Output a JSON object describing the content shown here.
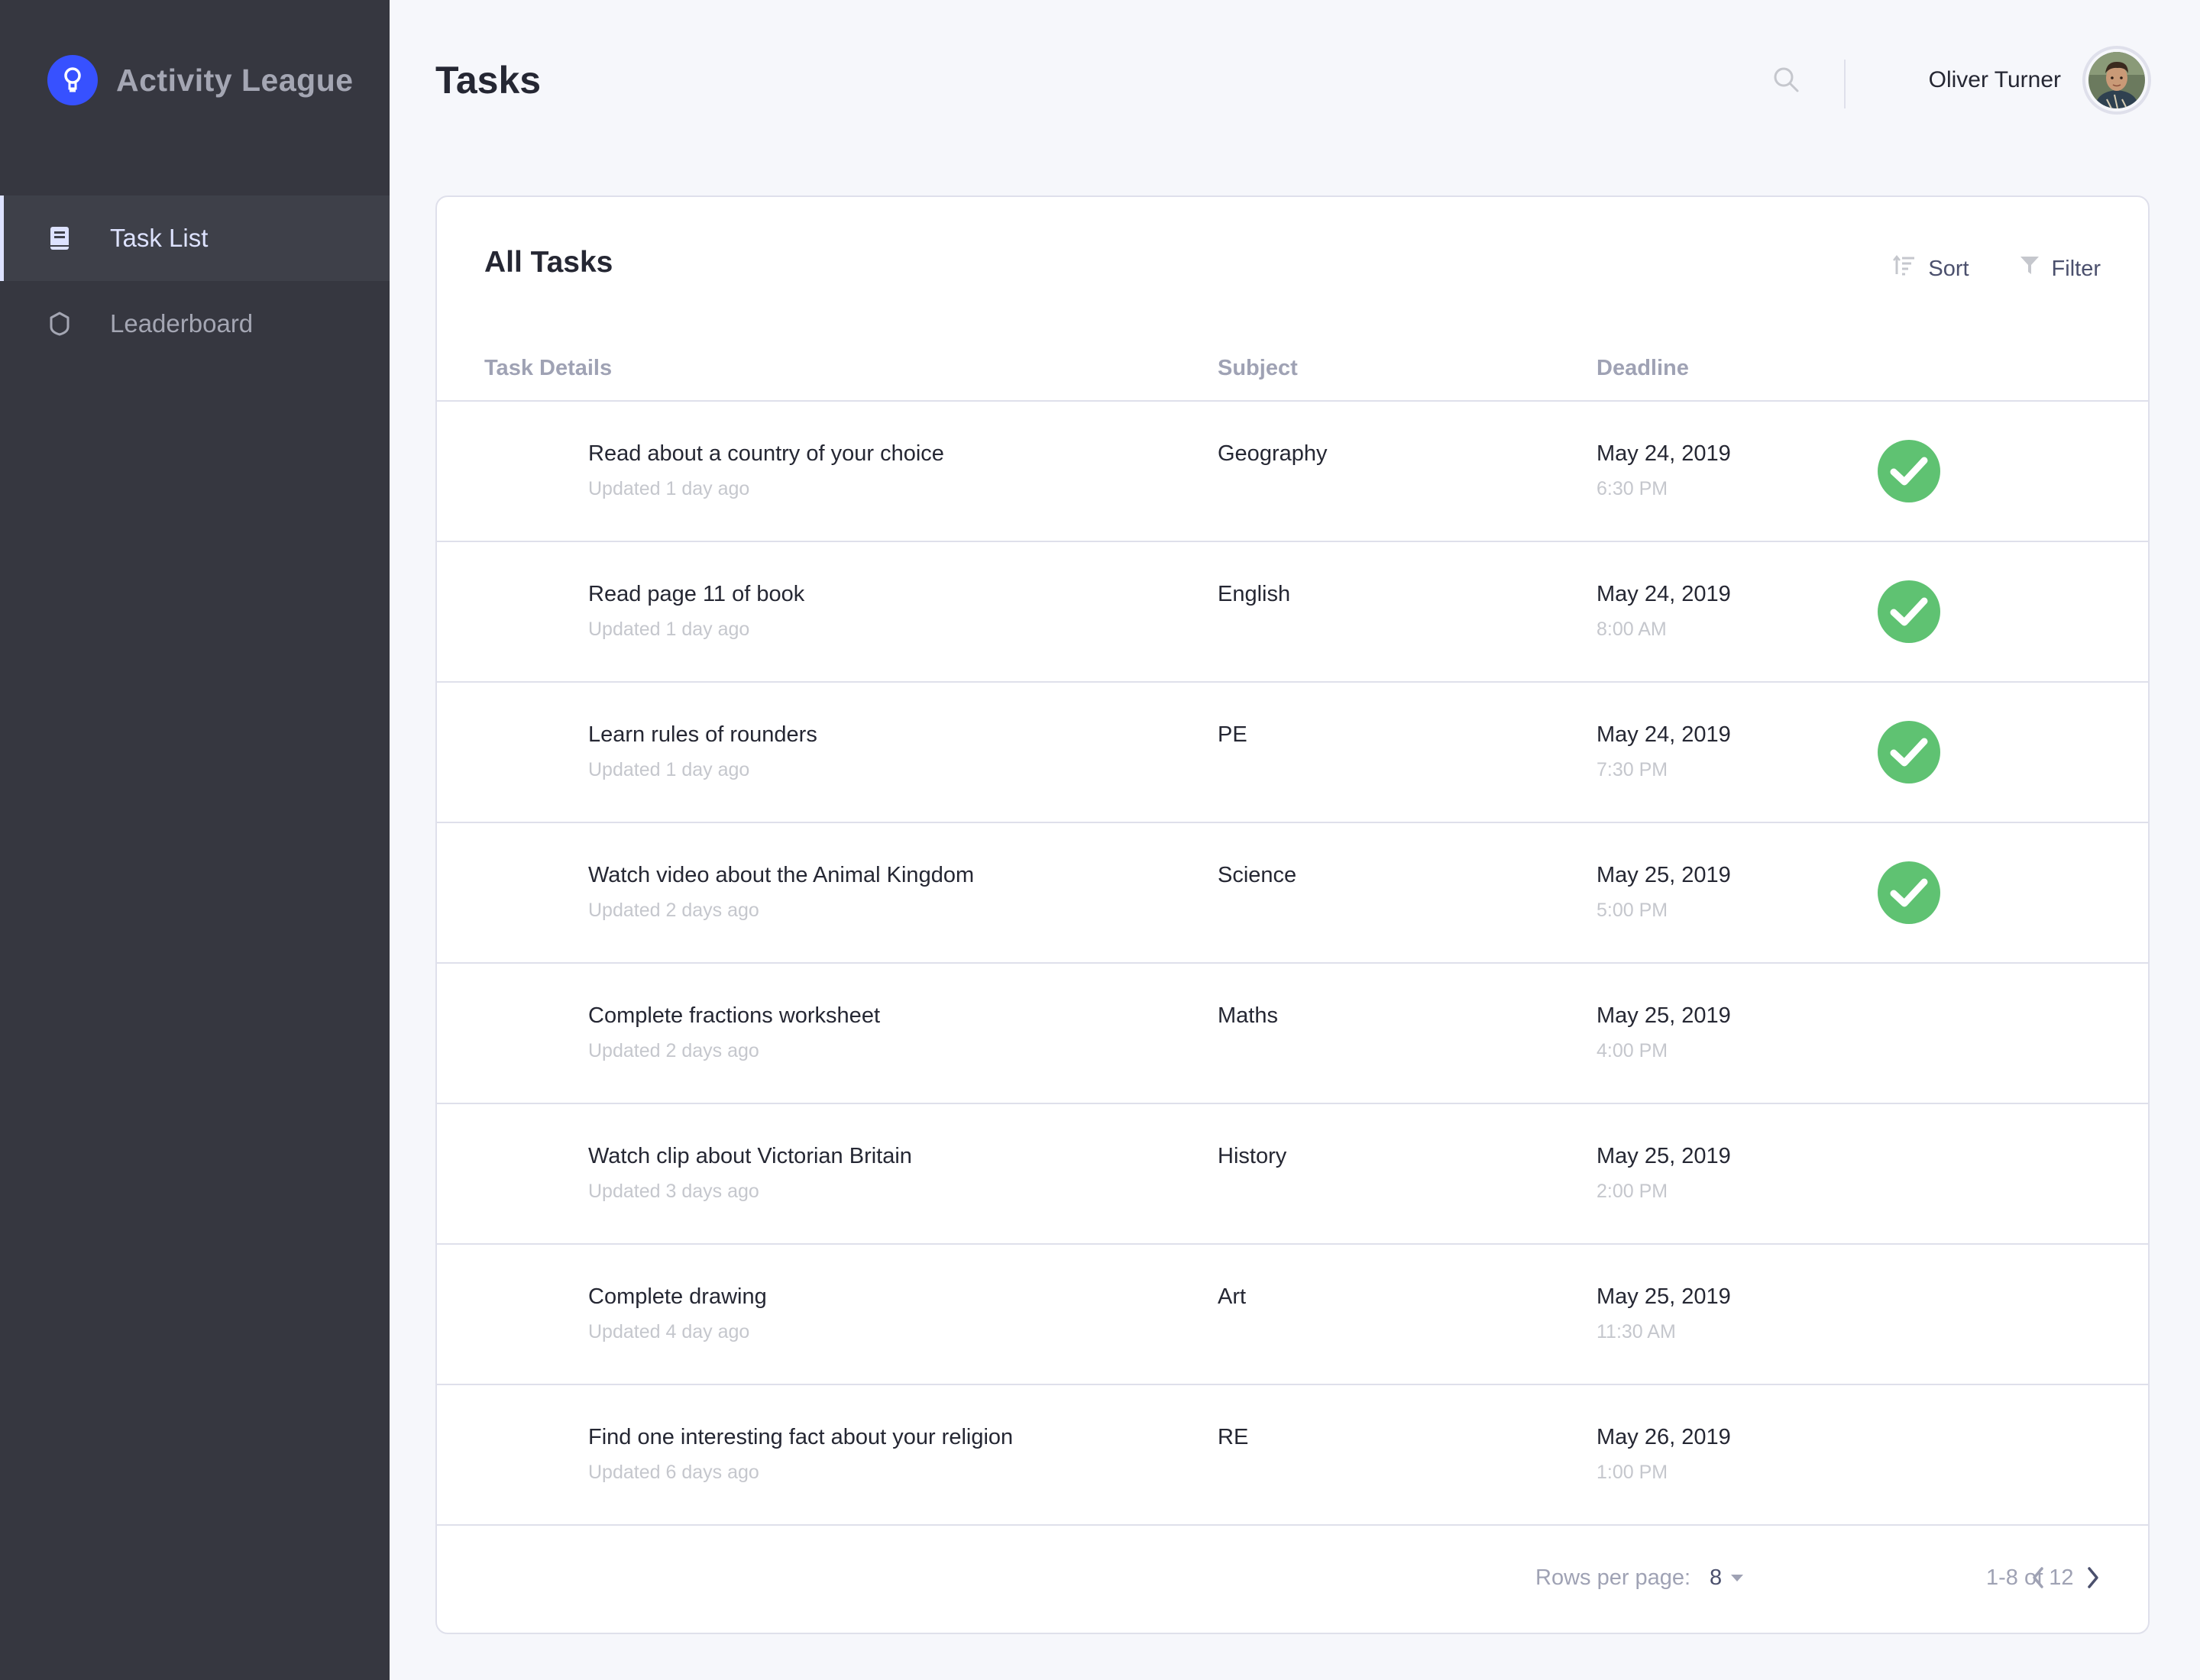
{
  "app": {
    "name": "Activity League"
  },
  "sidebar": {
    "items": [
      {
        "label": "Task List",
        "icon": "book-icon",
        "active": true
      },
      {
        "label": "Leaderboard",
        "icon": "shield-icon",
        "active": false
      }
    ]
  },
  "header": {
    "title": "Tasks",
    "user_name": "Oliver Turner"
  },
  "card": {
    "title": "All Tasks",
    "sort_label": "Sort",
    "filter_label": "Filter",
    "columns": [
      "Task Details",
      "Subject",
      "Deadline"
    ]
  },
  "tasks": [
    {
      "name": "Read about a country of your choice",
      "updated": "Updated 1 day ago",
      "subject": "Geography",
      "date": "May 24, 2019",
      "time": "6:30 PM",
      "completed": true
    },
    {
      "name": "Read page 11 of book",
      "updated": "Updated 1 day ago",
      "subject": "English",
      "date": "May 24, 2019",
      "time": "8:00 AM",
      "completed": true
    },
    {
      "name": "Learn rules of rounders",
      "updated": "Updated 1 day ago",
      "subject": "PE",
      "date": "May 24, 2019",
      "time": "7:30 PM",
      "completed": true
    },
    {
      "name": "Watch video about the Animal Kingdom",
      "updated": "Updated 2 days ago",
      "subject": "Science",
      "date": "May 25, 2019",
      "time": "5:00 PM",
      "completed": true
    },
    {
      "name": "Complete fractions worksheet",
      "updated": "Updated 2 days ago",
      "subject": "Maths",
      "date": "May 25, 2019",
      "time": "4:00 PM",
      "completed": false
    },
    {
      "name": "Watch clip about Victorian Britain",
      "updated": "Updated 3 days ago",
      "subject": "History",
      "date": "May 25, 2019",
      "time": "2:00 PM",
      "completed": false
    },
    {
      "name": "Complete drawing",
      "updated": "Updated 4 day ago",
      "subject": "Art",
      "date": "May 25, 2019",
      "time": "11:30 AM",
      "completed": false
    },
    {
      "name": "Find one interesting fact about your religion",
      "updated": "Updated 6 days ago",
      "subject": "RE",
      "date": "May 26, 2019",
      "time": "1:00 PM",
      "completed": false
    }
  ],
  "pagination": {
    "rows_per_page_label": "Rows per page:",
    "rows_per_page": "8",
    "range": "1-8 of 12"
  },
  "colors": {
    "sidebar_bg": "#363740",
    "accent": "#3751ff",
    "complete": "#5fc272",
    "page_bg": "#f6f7fb"
  }
}
